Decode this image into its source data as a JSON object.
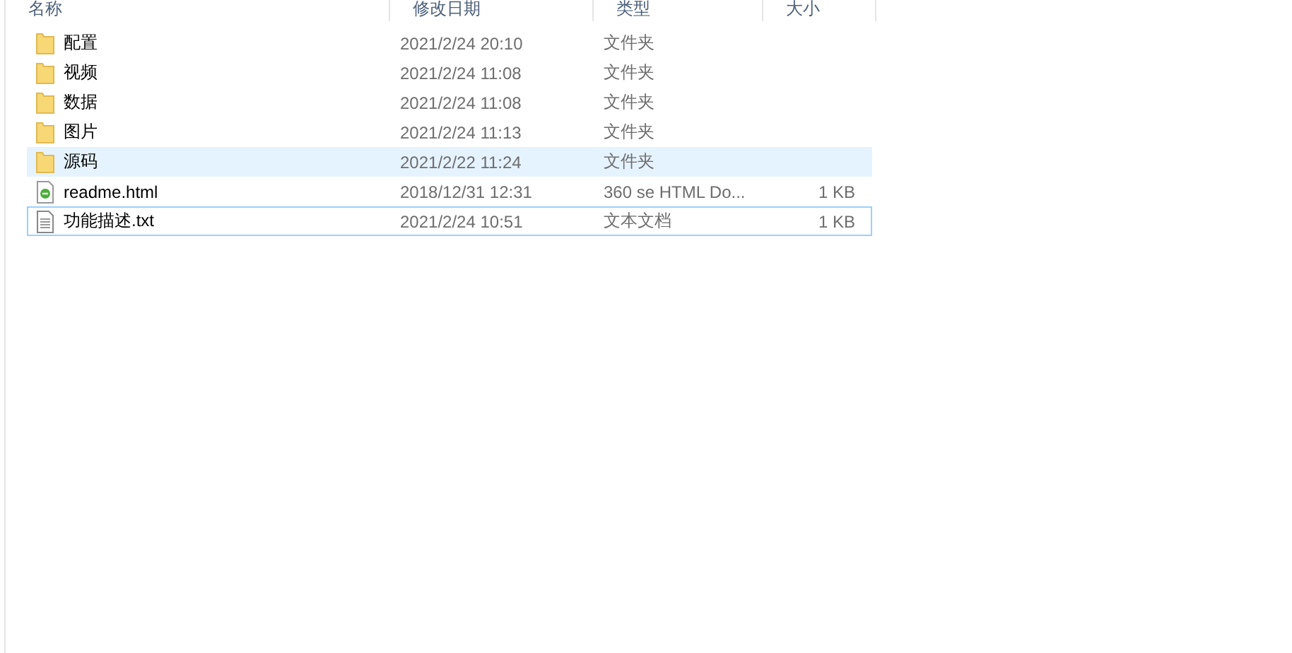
{
  "columns": [
    {
      "label": "名称"
    },
    {
      "label": "修改日期"
    },
    {
      "label": "类型"
    },
    {
      "label": "大小"
    }
  ],
  "rows": [
    {
      "name": "配置",
      "modified": "2021/2/24 20:10",
      "type": "文件夹",
      "kind": "folder",
      "hovered": false,
      "focused": false
    },
    {
      "name": "视频",
      "modified": "2021/2/24 11:08",
      "type": "文件夹",
      "kind": "folder",
      "hovered": false,
      "focused": false
    },
    {
      "name": "数据",
      "modified": "2021/2/24 11:08",
      "type": "文件夹",
      "kind": "folder",
      "hovered": false,
      "focused": false
    },
    {
      "name": "图片",
      "modified": "2021/2/24 11:13",
      "type": "文件夹",
      "kind": "folder",
      "hovered": false,
      "focused": false
    },
    {
      "name": "源码",
      "modified": "2021/2/22 11:24",
      "type": "文件夹",
      "kind": "folder",
      "hovered": true,
      "focused": false
    },
    {
      "name": "readme.html",
      "modified": "2018/12/31 12:31",
      "type": "360 se HTML Do...",
      "size": "1 KB",
      "kind": "html",
      "hovered": false,
      "focused": false
    },
    {
      "name": "功能描述.txt",
      "modified": "2021/2/24 10:51",
      "type": "文本文档",
      "size": "1 KB",
      "kind": "text",
      "hovered": false,
      "focused": true
    }
  ]
}
